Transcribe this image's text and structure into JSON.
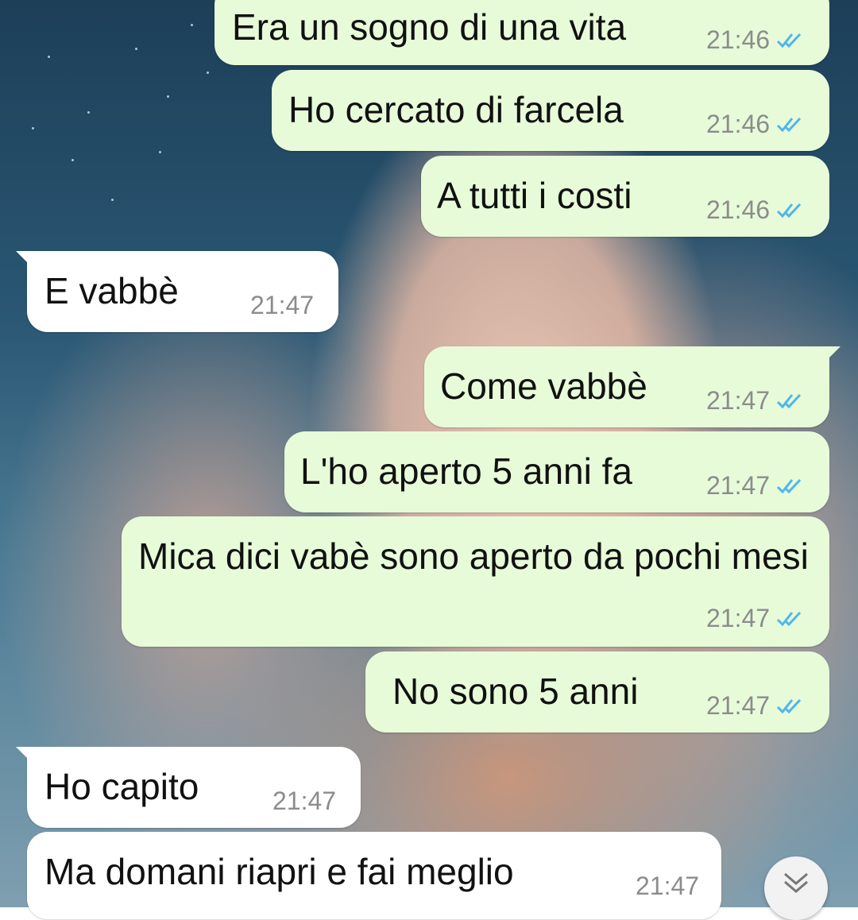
{
  "messages": [
    {
      "direction": "out",
      "text": "Era un sogno di una vita",
      "time": "21:46",
      "status": "read"
    },
    {
      "direction": "out",
      "text": "Ho cercato di farcela",
      "time": "21:46",
      "status": "read"
    },
    {
      "direction": "out",
      "text": "A tutti i costi",
      "time": "21:46",
      "status": "read"
    },
    {
      "direction": "in",
      "text": "E vabbè",
      "time": "21:47"
    },
    {
      "direction": "out",
      "text": "Come vabbè",
      "time": "21:47",
      "status": "read"
    },
    {
      "direction": "out",
      "text": "L'ho aperto 5 anni fa",
      "time": "21:47",
      "status": "read"
    },
    {
      "direction": "out",
      "text": "Mica dici vabè sono aperto da pochi mesi",
      "time": "21:47",
      "status": "read"
    },
    {
      "direction": "out",
      "text": "No sono 5 anni",
      "time": "21:47",
      "status": "read"
    },
    {
      "direction": "in",
      "text": "Ho capito",
      "time": "21:47"
    },
    {
      "direction": "in",
      "text": "Ma domani riapri e fai meglio",
      "time": "21:47"
    }
  ],
  "colors": {
    "outgoing_bubble": "#e7fbd9",
    "incoming_bubble": "#ffffff",
    "timestamp": "#8c8c8c",
    "read_ticks": "#4fb6ec"
  },
  "icons": {
    "read_receipt": "double-check-icon",
    "scroll_down": "chevron-double-down-icon"
  }
}
